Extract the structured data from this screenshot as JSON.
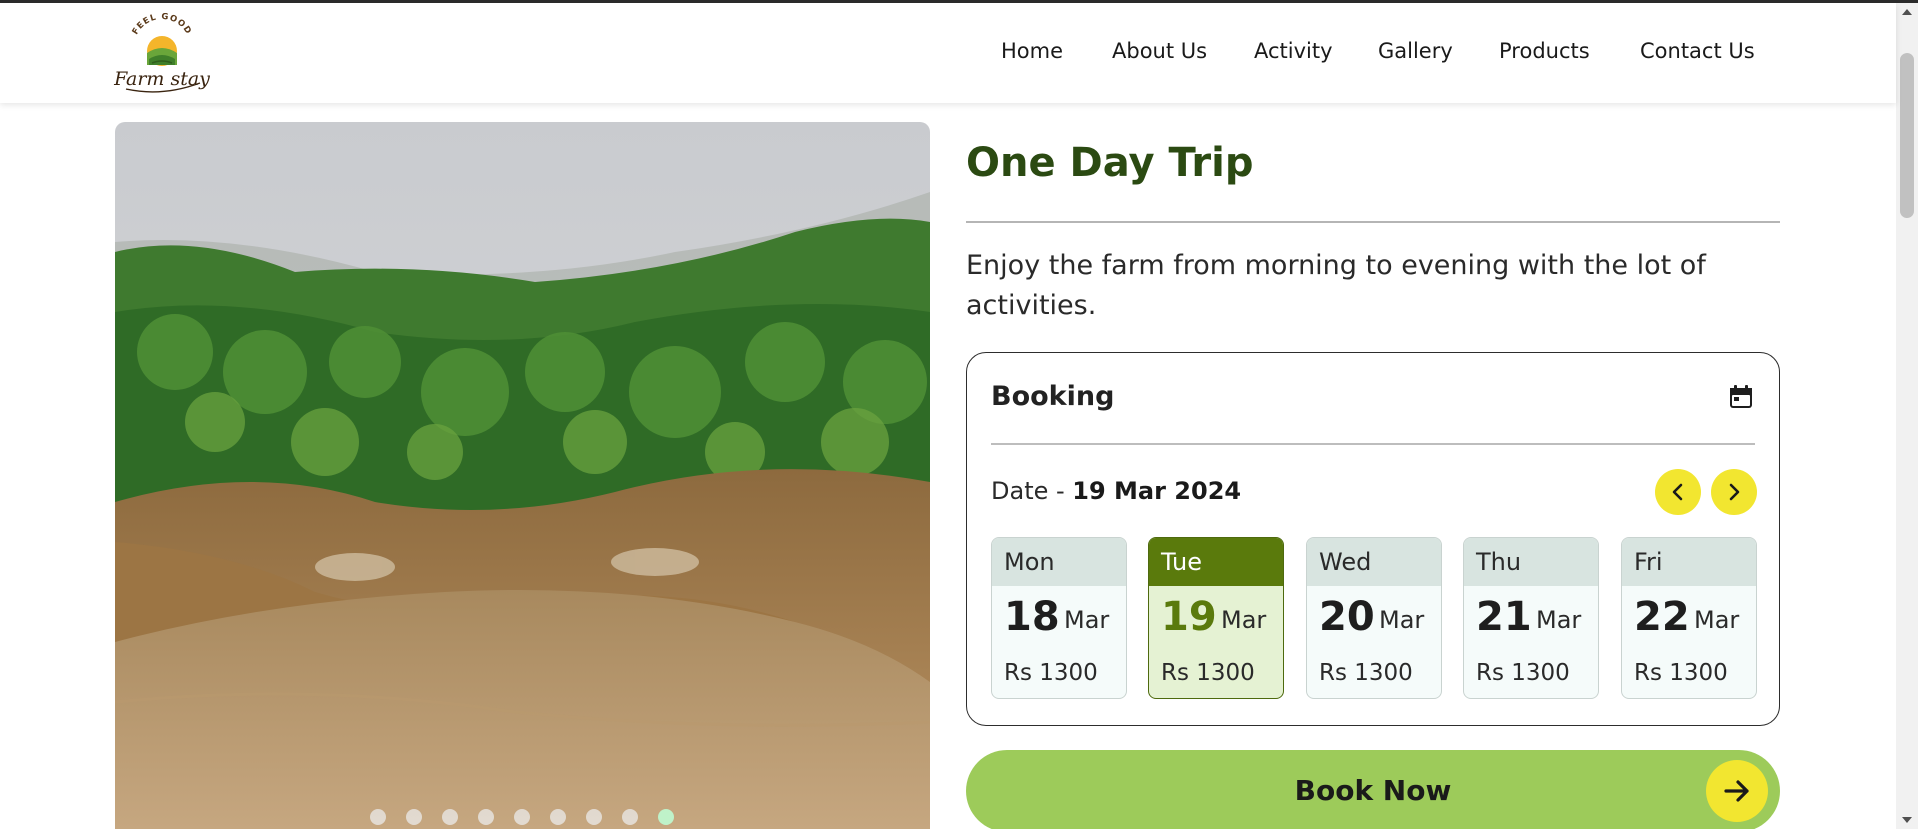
{
  "brand": {
    "logo_top_text": "FEEL GOOD",
    "logo_name": "Farm stay"
  },
  "nav": {
    "items": [
      "Home",
      "About Us",
      "Activity",
      "Gallery",
      "Products",
      "Contact Us"
    ]
  },
  "trip": {
    "title": "One Day Trip",
    "description": "Enjoy the farm from morning to evening with the lot of activities."
  },
  "booking": {
    "title": "Booking",
    "date_prefix": "Date - ",
    "selected_date": "19 Mar 2024",
    "days": [
      {
        "day": "Mon",
        "date": "18",
        "month": "Mar",
        "price": "Rs 1300",
        "selected": false
      },
      {
        "day": "Tue",
        "date": "19",
        "month": "Mar",
        "price": "Rs 1300",
        "selected": true
      },
      {
        "day": "Wed",
        "date": "20",
        "month": "Mar",
        "price": "Rs 1300",
        "selected": false
      },
      {
        "day": "Thu",
        "date": "21",
        "month": "Mar",
        "price": "Rs 1300",
        "selected": false
      },
      {
        "day": "Fri",
        "date": "22",
        "month": "Mar",
        "price": "Rs 1300",
        "selected": false
      }
    ]
  },
  "cta": {
    "label": "Book Now"
  },
  "carousel": {
    "slide_count": 9,
    "active_index": 8
  },
  "colors": {
    "title_green": "#2b4a12",
    "selected_day_green": "#5a7a0c",
    "cta_green": "#9dcb5a",
    "accent_yellow": "#f2e630"
  },
  "icons": {
    "calendar": "calendar-icon",
    "prev": "chevron-left-icon",
    "next": "chevron-right-icon",
    "cta": "arrow-right-icon"
  }
}
